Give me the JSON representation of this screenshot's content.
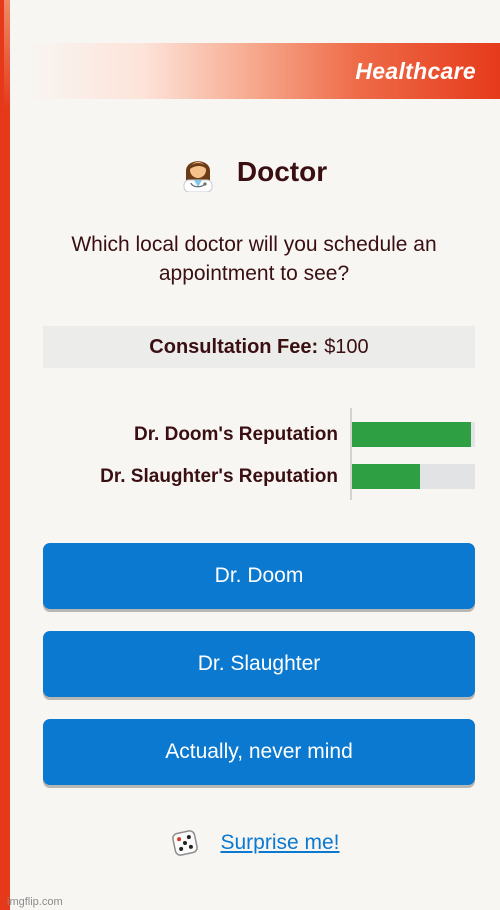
{
  "category": {
    "label": "Healthcare"
  },
  "event": {
    "icon": "doctor-emoji-icon",
    "title": "Doctor",
    "question": "Which local doctor will you schedule an appointment to see?"
  },
  "fee": {
    "label": "Consultation Fee:",
    "value": "$100"
  },
  "reputation": [
    {
      "label": "Dr. Doom's Reputation",
      "level": 0.97
    },
    {
      "label": "Dr. Slaughter's Reputation",
      "level": 0.55
    }
  ],
  "choices": [
    "Dr. Doom",
    "Dr. Slaughter",
    "Actually, never mind"
  ],
  "surprise": {
    "icon": "dice-icon",
    "label": "Surprise me!"
  },
  "watermark": "imgflip.com",
  "colors": {
    "accent": "#e5391a",
    "button": "#0a79cf",
    "bar_fill": "#2ea043",
    "bar_track": "#e2e3e5",
    "text": "#3a0f12"
  }
}
